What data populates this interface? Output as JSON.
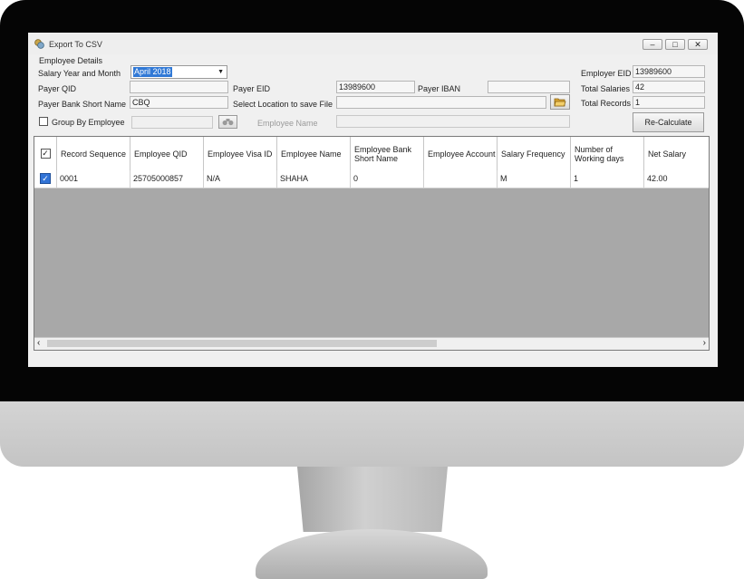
{
  "window": {
    "title": "Export To CSV",
    "controls": {
      "minimize": "–",
      "maximize": "□",
      "close": "✕"
    }
  },
  "group_label": "Employee Details",
  "form": {
    "salary_year_month_label": "Salary Year and Month",
    "salary_year_month_value": "April 2018",
    "payer_qid_label": "Payer QID",
    "payer_qid_value": "",
    "payer_eid_label": "Payer EID",
    "payer_eid_value": "13989600",
    "payer_iban_label": "Payer IBAN",
    "payer_iban_value": "",
    "payer_bank_label": "Payer Bank Short Name",
    "payer_bank_value": "CBQ",
    "location_label": "Select Location to save File",
    "location_value": "",
    "group_by_label": "Group By Employee",
    "group_by_checked": false,
    "group_by_value": "",
    "employee_name_label": "Employee Name",
    "employee_name_value": "",
    "employer_eid_label": "Employer EID",
    "employer_eid_value": "13989600",
    "total_salaries_label": "Total Salaries",
    "total_salaries_value": "42",
    "total_records_label": "Total Records",
    "total_records_value": "1",
    "recalculate_label": "Re-Calculate"
  },
  "grid": {
    "columns": [
      "Record Sequence",
      "Employee QID",
      "Employee Visa ID",
      "Employee Name",
      "Employee Bank Short Name",
      "Employee Account",
      "Salary Frequency",
      "Number of Working days",
      "Net Salary"
    ],
    "rows": [
      {
        "checked": true,
        "cells": [
          "0001",
          "25705000857",
          "N/A",
          "SHAHA",
          "0",
          "",
          "M",
          "1",
          "42.00"
        ]
      }
    ]
  },
  "icons": {
    "app": "coins-icon",
    "folder": "folder-open-icon",
    "search": "binoculars-icon"
  },
  "colors": {
    "selection": "#3179d6",
    "grid_background": "#a8a8a8",
    "window_background": "#f0f0f0"
  }
}
